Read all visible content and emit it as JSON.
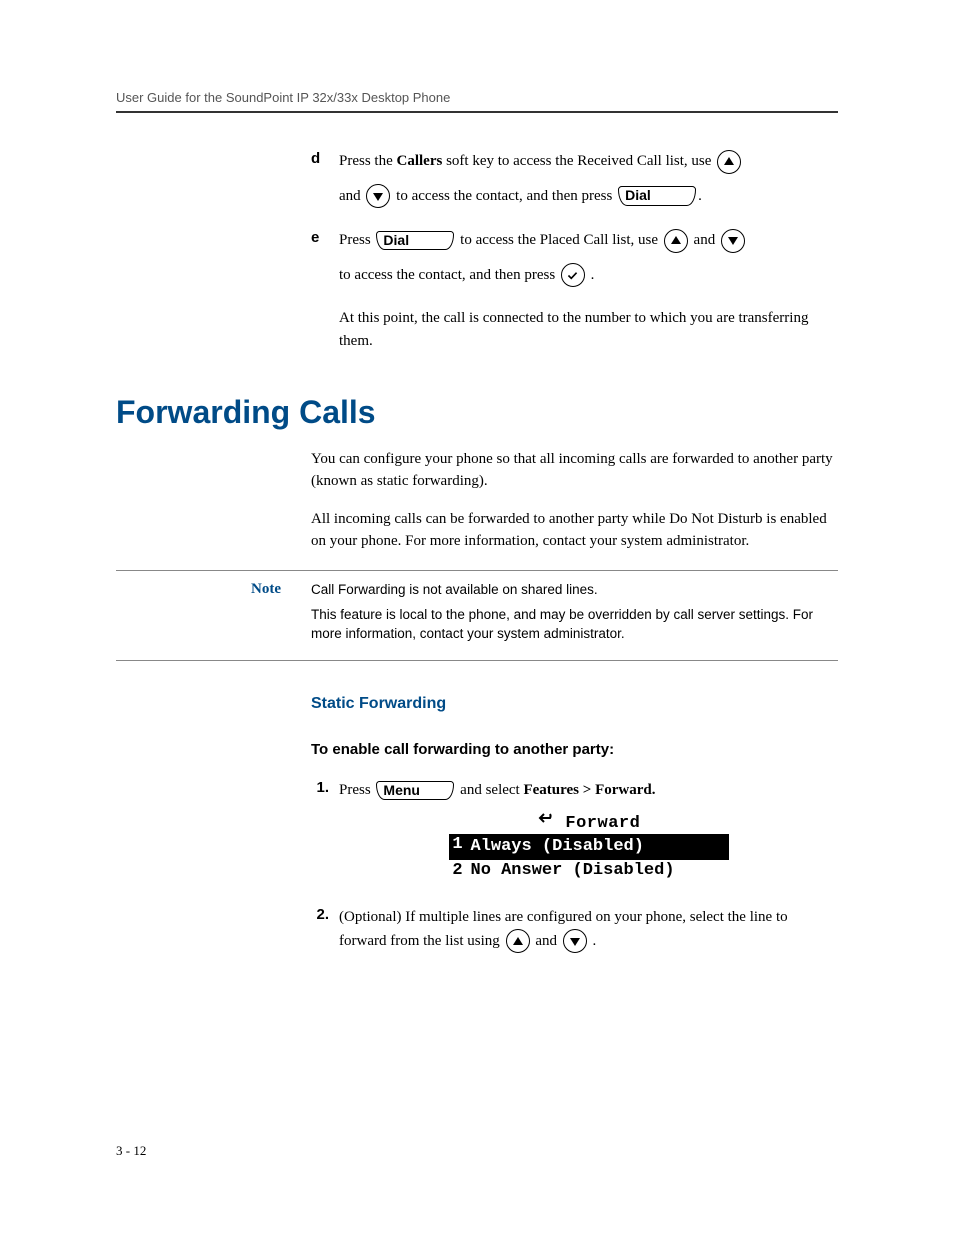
{
  "header": {
    "title": "User Guide for the SoundPoint IP 32x/33x Desktop Phone"
  },
  "steps": {
    "d": {
      "letter": "d",
      "text1a": "Press the ",
      "callers_bold": "Callers",
      "text1b": " soft key to access the Received Call list, use ",
      "text2a": "and ",
      "text2b": " to access the contact, and then press ",
      "text2c": ".",
      "dial_label": "Dial"
    },
    "e": {
      "letter": "e",
      "text1a": "Press ",
      "dial_label": "Dial",
      "text1b": " to access the Placed Call list, use ",
      "text1c": " and ",
      "text2a": "to access the contact, and then press ",
      "text2b": " ."
    },
    "followup": "At this point, the call is connected to the number to which you are transferring them."
  },
  "section": {
    "h1": "Forwarding Calls",
    "para1": "You can configure your phone so that all incoming calls are forwarded to another party (known as static forwarding).",
    "para2": "All incoming calls can be forwarded to another party while Do Not Disturb is enabled on your phone. For more information, contact your system administrator."
  },
  "note": {
    "label": "Note",
    "line1": "Call Forwarding is not available on shared lines.",
    "line2": "This feature is local to the phone, and may be overridden by call server settings. For more information, contact your system administrator."
  },
  "static_forwarding": {
    "h3": "Static Forwarding",
    "h4": "To enable call forwarding to another party:",
    "step1": {
      "num": "1.",
      "pre": "Press ",
      "menu_label": "Menu",
      "mid": " and select ",
      "path": "Features > Forward."
    },
    "lcd": {
      "title": "Forward",
      "line1_num": "1",
      "line1_text": "Always (Disabled)",
      "line2_num": "2",
      "line2_text": "No Answer (Disabled)"
    },
    "step2": {
      "num": "2.",
      "text1": "(Optional) If multiple lines are configured on your phone, select the line to forward from the list using ",
      "text2": " and ",
      "text3": " ."
    }
  },
  "footer": {
    "page": "3 - 12"
  }
}
